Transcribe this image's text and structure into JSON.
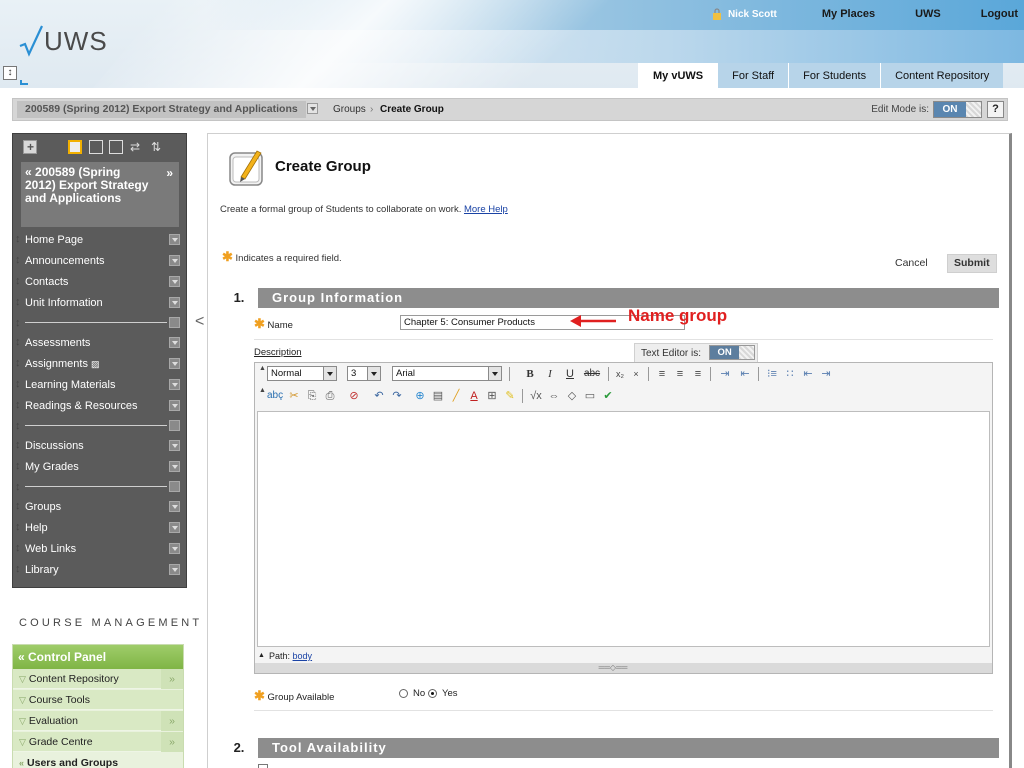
{
  "header": {
    "logo_text": "UWS",
    "user_name": "Nick Scott",
    "links": [
      "My Places",
      "UWS",
      "Logout"
    ],
    "tabs": [
      {
        "label": "My vUWS",
        "active": true
      },
      {
        "label": "For Staff",
        "active": false
      },
      {
        "label": "For Students",
        "active": false
      },
      {
        "label": "Content Repository",
        "active": false
      }
    ]
  },
  "breadcrumb": {
    "course": "200589 (Spring 2012) Export Strategy and Applications",
    "groups": "Groups",
    "separator": "›",
    "current": "Create Group",
    "edit_mode_label": "Edit Mode is:",
    "edit_mode_value": "ON",
    "help": "?"
  },
  "course_menu": {
    "title": "200589 (Spring 2012) Export Strategy and Applications",
    "title_arrow": "»",
    "items": [
      "Home Page",
      "Announcements",
      "Contacts",
      "Unit Information",
      "Assessments",
      "Assignments",
      "Learning Materials",
      "Readings & Resources",
      "Discussions",
      "My Grades",
      "Groups",
      "Help",
      "Web Links",
      "Library"
    ],
    "toggle": "<"
  },
  "course_management": {
    "title": "COURSE MANAGEMENT",
    "control_panel": "Control Panel",
    "items": [
      {
        "label": "Content Repository",
        "expand": "»"
      },
      {
        "label": "Course Tools",
        "expand": ""
      },
      {
        "label": "Evaluation",
        "expand": "»"
      },
      {
        "label": "Grade Centre",
        "expand": "»"
      },
      {
        "label": "Users and Groups",
        "expand": ""
      }
    ]
  },
  "main": {
    "title": "Create Group",
    "description": "Create a formal group of Students to collaborate on work.",
    "more_help": "More Help",
    "required_note": "Indicates a required field.",
    "cancel": "Cancel",
    "submit": "Submit",
    "section1": {
      "number": "1.",
      "title": "Group Information"
    },
    "name_label": "Name",
    "name_value": "Chapter 5: Consumer Products",
    "annotation": "Name group",
    "description_label": "Description",
    "text_editor_label": "Text Editor is:",
    "text_editor_value": "ON",
    "format_value": "Normal",
    "size_value": "3",
    "font_value": "Arial",
    "path_label": "Path:",
    "path_value": "body",
    "group_available_label": "Group Available",
    "radio_no": "No",
    "radio_yes": "Yes",
    "group_available_value": "Yes",
    "section2": {
      "number": "2.",
      "title": "Tool Availability"
    }
  },
  "colors": {
    "annotation_red": "#e02020",
    "required_star": "#f0a020",
    "link_blue": "#1a43a5",
    "control_panel_green": "#8cc056"
  }
}
